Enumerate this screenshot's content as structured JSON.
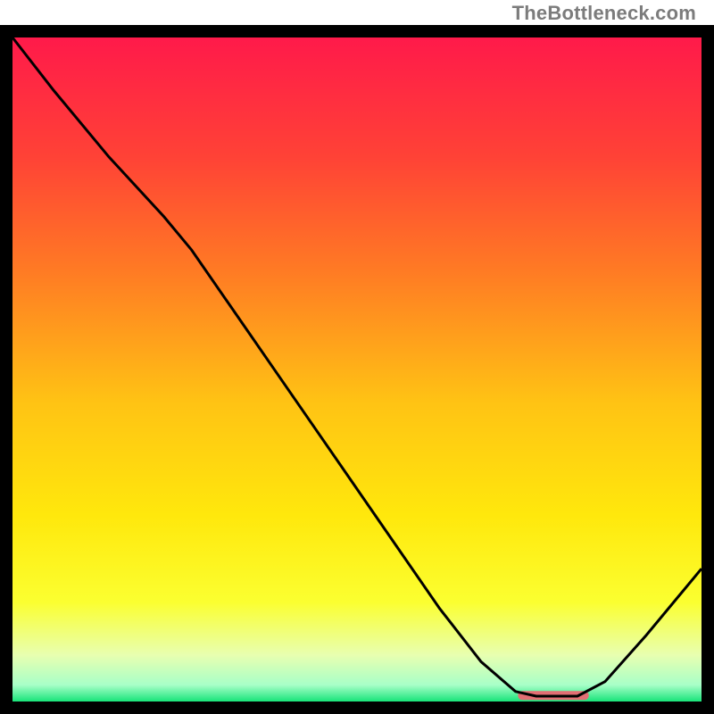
{
  "watermark": "TheBottleneck.com",
  "chart_data": {
    "type": "line",
    "title": "",
    "xlabel": "",
    "ylabel": "",
    "xlim": [
      0,
      100
    ],
    "ylim": [
      0,
      100
    ],
    "background_gradient": {
      "stops": [
        {
          "offset": 0.0,
          "color": "#ff1a4a"
        },
        {
          "offset": 0.18,
          "color": "#ff4236"
        },
        {
          "offset": 0.35,
          "color": "#ff7a24"
        },
        {
          "offset": 0.55,
          "color": "#ffc314"
        },
        {
          "offset": 0.72,
          "color": "#ffe80c"
        },
        {
          "offset": 0.85,
          "color": "#fbff30"
        },
        {
          "offset": 0.93,
          "color": "#e8ffb0"
        },
        {
          "offset": 0.975,
          "color": "#a8ffc8"
        },
        {
          "offset": 1.0,
          "color": "#18e47a"
        }
      ]
    },
    "curve_points": [
      {
        "x": 0,
        "y": 100
      },
      {
        "x": 6,
        "y": 92
      },
      {
        "x": 14,
        "y": 82
      },
      {
        "x": 22,
        "y": 73
      },
      {
        "x": 26,
        "y": 68
      },
      {
        "x": 32,
        "y": 59
      },
      {
        "x": 40,
        "y": 47
      },
      {
        "x": 48,
        "y": 35
      },
      {
        "x": 56,
        "y": 23
      },
      {
        "x": 62,
        "y": 14
      },
      {
        "x": 68,
        "y": 6
      },
      {
        "x": 73,
        "y": 1.5
      },
      {
        "x": 76,
        "y": 0.8
      },
      {
        "x": 82,
        "y": 0.8
      },
      {
        "x": 86,
        "y": 3
      },
      {
        "x": 92,
        "y": 10
      },
      {
        "x": 100,
        "y": 20
      }
    ],
    "curve_color": "#000000",
    "marker": {
      "x_start": 74,
      "x_end": 83,
      "y": 0.9,
      "color": "#e36f74",
      "thickness": 10
    },
    "plot_border_color": "#000000",
    "plot_border_width": 14,
    "plot_inner_margin_top": 28
  }
}
